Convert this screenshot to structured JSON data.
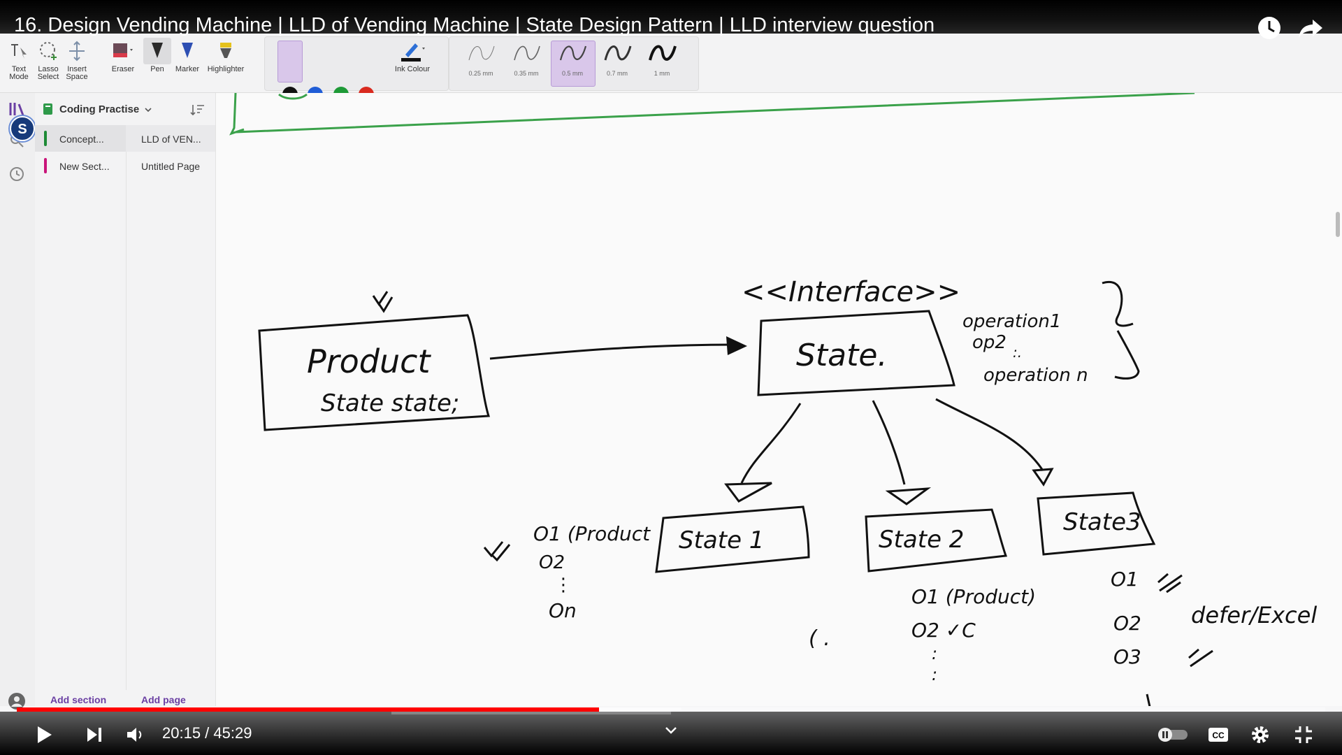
{
  "video": {
    "title": "16. Design Vending Machine | LLD of Vending Machine | State Design Pattern | LLD interview question",
    "time": "20:15 / 45:29",
    "progress_fraction": 0.445
  },
  "ribbon": {
    "text_mode": "Text Mode",
    "lasso_select": "Lasso Select",
    "insert_space": "Insert Space",
    "eraser": "Eraser",
    "pen": "Pen",
    "marker": "Marker",
    "highlighter": "Highlighter",
    "ink_colour": "Ink Colour",
    "colors": [
      "#111111",
      "#1f5cd6",
      "#1e9a37",
      "#d92a1f"
    ],
    "thickness": [
      "0.25 mm",
      "0.35 mm",
      "0.5 mm",
      "0.7 mm",
      "1 mm"
    ]
  },
  "notebook": {
    "name": "Coding Practise",
    "sections": [
      "Concept...",
      "New Sect..."
    ],
    "pages": [
      "LLD of VEN...",
      "Untitled Page"
    ],
    "add_section": "Add section",
    "add_page": "Add page"
  },
  "canvas": {
    "interface_label": "<<Interface>>",
    "product_box": "Product",
    "product_field": "State state;",
    "state_box": "State.",
    "ops": [
      "operation1",
      "op2",
      ":.",
      "operation n"
    ],
    "state1": "State 1",
    "state2": "State 2",
    "state3": "State3",
    "s1_ops": [
      "O1 (Product",
      "O2",
      "⋮",
      "On"
    ],
    "s2_ops": [
      "O1 (Product)",
      "O2 ✓C",
      ":",
      ":"
    ],
    "s3_ops": [
      "O1",
      "O2",
      "O3"
    ],
    "s3_note": "defer/Excel",
    "paren": "(  ."
  }
}
